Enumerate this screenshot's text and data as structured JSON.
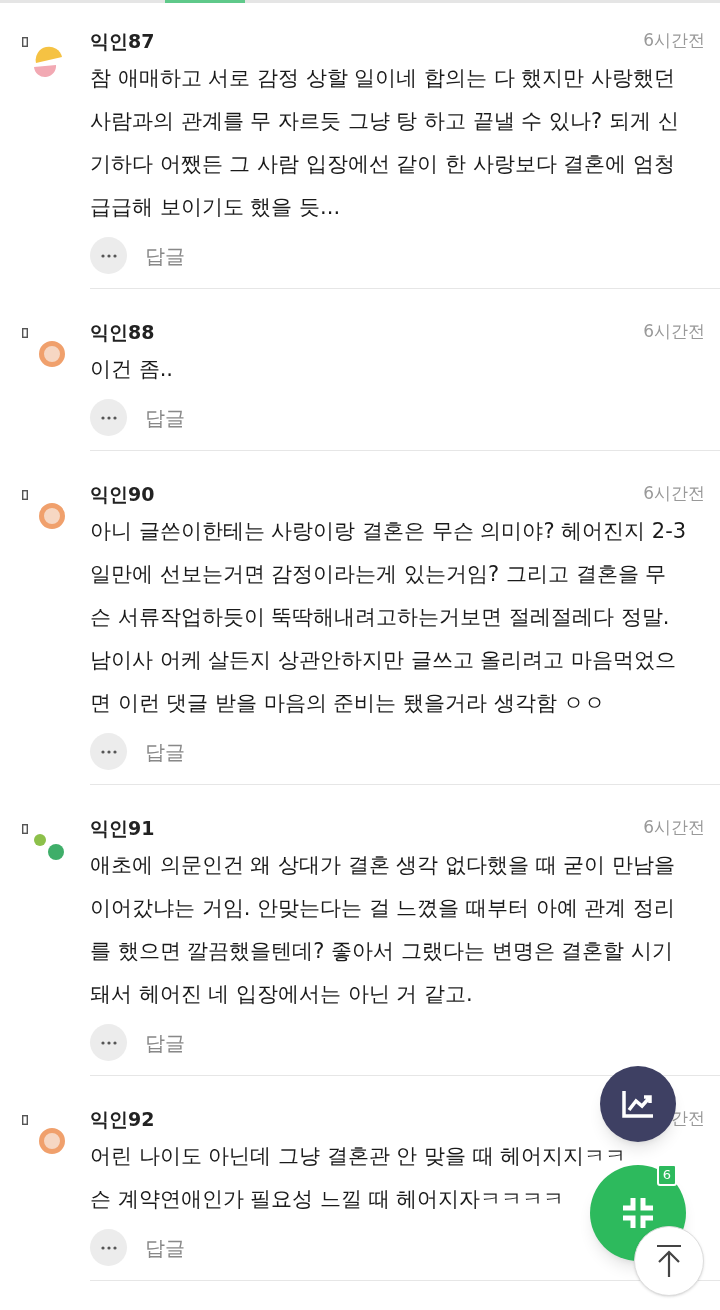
{
  "comments": [
    {
      "author": "익인87",
      "time": "6시간전",
      "kind": "sun",
      "lines": [
        "참 애매하고 서로 감정 상할 일이네 합의는 다 했지만 사랑했던",
        "사람과의 관계를 무 자르듯 그냥 탕 하고 끝낼 수 있나? 되게 신",
        "기하다 어쨌든 그 사람 입장에선 같이 한 사랑보다 결혼에 엄청",
        "급급해 보이기도 했을 듯..."
      ],
      "reply": "답글"
    },
    {
      "author": "익인88",
      "time": "6시간전",
      "kind": "ring",
      "lines": [
        "이건 좀.."
      ],
      "reply": "답글"
    },
    {
      "author": "익인90",
      "time": "6시간전",
      "kind": "ring",
      "lines": [
        "아니 글쓴이한테는 사랑이랑 결혼은 무슨 의미야? 헤어진지 2-3",
        "일만에 선보는거면 감정이라는게 있는거임? 그리고 결혼을 무",
        "슨 서류작업하듯이 뚝딱해내려고하는거보면 절레절레다 정말.",
        "남이사 어케 살든지 상관안하지만 글쓰고 올리려고 마음먹었으",
        "면 이런 댓글 받을 마음의 준비는 됐을거라 생각함 ㅇㅇ"
      ],
      "reply": "답글"
    },
    {
      "author": "익인91",
      "time": "6시간전",
      "kind": "dots",
      "lines": [
        "애초에 의문인건 왜 상대가 결혼 생각 없다했을 때 굳이 만남을",
        "이어갔냐는 거임. 안맞는다는 걸 느꼈을 때부터 아예 관계 정리",
        "를 했으면 깔끔했을텐데? 좋아서 그랬다는 변명은 결혼할 시기",
        "돼서 헤어진 네 입장에서는 아닌 거 같고."
      ],
      "reply": "답글"
    },
    {
      "author": "익인92",
      "time": "간전",
      "kind": "ring",
      "lines": [
        "어린 나이도 아닌데 그냥 결혼관 안 맞을 때 헤어지지ㅋㅋ",
        "슨 계약연애인가 필요성 느낄 때 헤어지자ㅋㅋㅋㅋ"
      ],
      "reply": "답글"
    }
  ],
  "fab": {
    "badge": "6"
  }
}
